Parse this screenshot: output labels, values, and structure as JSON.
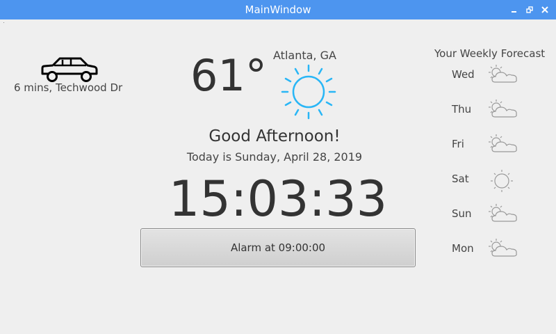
{
  "window": {
    "title": "MainWindow"
  },
  "commute": {
    "text": "6 mins, Techwood Dr",
    "icon": "car-icon"
  },
  "weather": {
    "temperature": "61°",
    "location": "Atlanta, GA",
    "condition_icon": "sun-icon",
    "accent_color": "#29b6f6"
  },
  "greeting": "Good Afternoon!",
  "today": "Today is Sunday, April 28, 2019",
  "clock": "15:03:33",
  "alarm": {
    "label": "Alarm at 09:00:00"
  },
  "forecast": {
    "title": "Your Weekly Forecast",
    "days": [
      {
        "day": "Wed",
        "icon": "partly-cloudy-icon"
      },
      {
        "day": "Thu",
        "icon": "partly-cloudy-icon"
      },
      {
        "day": "Fri",
        "icon": "partly-cloudy-icon"
      },
      {
        "day": "Sat",
        "icon": "sun-icon"
      },
      {
        "day": "Sun",
        "icon": "partly-cloudy-icon"
      },
      {
        "day": "Mon",
        "icon": "partly-cloudy-icon"
      }
    ]
  }
}
